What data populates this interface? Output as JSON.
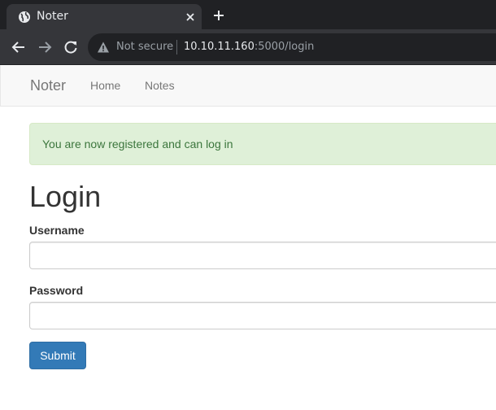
{
  "browser": {
    "tab": {
      "title": "Noter",
      "favicon": "globe-icon",
      "close_icon": "close-icon"
    },
    "new_tab_icon": "plus-icon",
    "nav_icons": [
      "back-arrow-icon",
      "forward-arrow-icon",
      "reload-icon"
    ],
    "address_bar": {
      "security_icon": "warning-triangle-icon",
      "security_label": "Not secure",
      "host": "10.10.11.160",
      "path": ":5000/login"
    }
  },
  "navbar": {
    "brand": "Noter",
    "links": [
      {
        "label": "Home"
      },
      {
        "label": "Notes"
      }
    ]
  },
  "alert": {
    "message": "You are now registered and can log in"
  },
  "form": {
    "title": "Login",
    "username_label": "Username",
    "username_value": "",
    "password_label": "Password",
    "password_value": "",
    "submit_label": "Submit"
  },
  "colors": {
    "chrome_dark": "#202124",
    "chrome_toolbar": "#35363a",
    "navbar_bg": "#f8f8f8",
    "alert_bg": "#dff0d8",
    "alert_text": "#3c763d",
    "button_primary": "#337ab7"
  }
}
